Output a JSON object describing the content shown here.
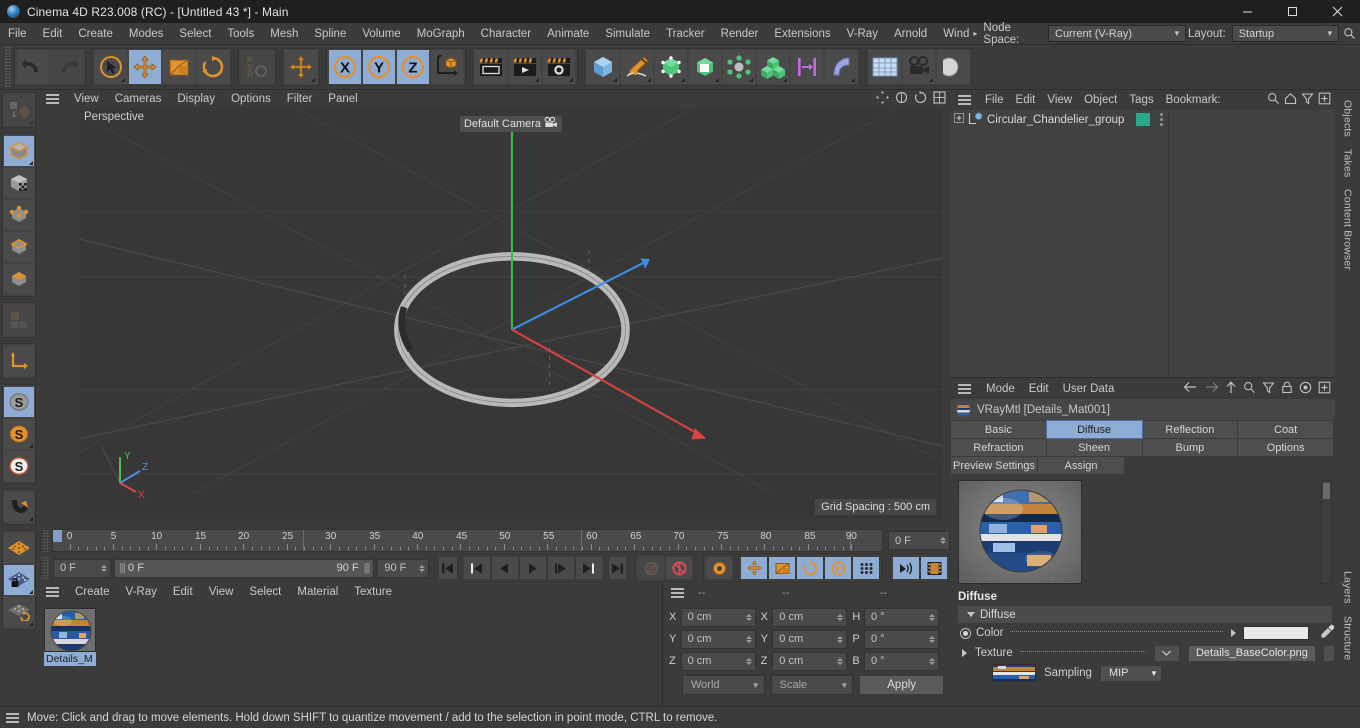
{
  "window": {
    "title": "Cinema 4D R23.008 (RC) - [Untitled 43 *] - Main",
    "minimize": "–",
    "maximize": "□",
    "close": "✕"
  },
  "menubar": {
    "items": [
      "File",
      "Edit",
      "Create",
      "Modes",
      "Select",
      "Tools",
      "Mesh",
      "Spline",
      "Volume",
      "MoGraph",
      "Character",
      "Animate",
      "Simulate",
      "Tracker",
      "Render",
      "Extensions",
      "V-Ray",
      "Arnold",
      "Wind"
    ],
    "overflow_arrow": "▸",
    "node_space_label": "Node Space:",
    "node_space_value": "Current (V-Ray)",
    "layout_label": "Layout:",
    "layout_value": "Startup",
    "search_icon": "search-icon"
  },
  "toolbar": {
    "groups": [
      {
        "name": "history",
        "buttons": [
          {
            "name": "undo-button",
            "icon": "undo-arrow-icon",
            "active": false,
            "disabled": false
          },
          {
            "name": "redo-button",
            "icon": "redo-arrow-icon",
            "active": false,
            "disabled": true
          }
        ]
      },
      {
        "name": "transform",
        "buttons": [
          {
            "name": "live-selection-tool",
            "icon": "cursor-circle-icon",
            "active": false,
            "disabled": false
          },
          {
            "name": "move-tool",
            "icon": "move-arrows-icon",
            "active": true,
            "disabled": false
          },
          {
            "name": "scale-tool",
            "icon": "scale-box-icon",
            "active": false,
            "disabled": false
          },
          {
            "name": "rotate-tool",
            "icon": "rotate-arrows-icon",
            "active": false,
            "disabled": false
          }
        ]
      },
      {
        "name": "psr",
        "buttons": [
          {
            "name": "psr-lock-button",
            "icon": "psr-icon",
            "active": false,
            "disabled": true
          }
        ]
      },
      {
        "name": "world-move",
        "buttons": [
          {
            "name": "world-move-tool",
            "icon": "move-arrows-icon",
            "active": false,
            "disabled": false
          }
        ]
      },
      {
        "name": "axis-locks",
        "buttons": [
          {
            "name": "lock-x-axis",
            "icon": "x-axis-icon",
            "label": "X",
            "active": true,
            "disabled": false
          },
          {
            "name": "lock-y-axis",
            "icon": "y-axis-icon",
            "label": "Y",
            "active": true,
            "disabled": false
          },
          {
            "name": "lock-z-axis",
            "icon": "z-axis-icon",
            "label": "Z",
            "active": true,
            "disabled": false
          },
          {
            "name": "object-world-coordinates",
            "icon": "object-axis-icon",
            "active": false,
            "disabled": false
          }
        ]
      },
      {
        "name": "render",
        "buttons": [
          {
            "name": "render-view-button",
            "icon": "render-view-icon",
            "active": false,
            "disabled": false
          },
          {
            "name": "render-to-picture-viewer-button",
            "icon": "render-picture-icon",
            "active": false,
            "disabled": false
          },
          {
            "name": "render-settings-button",
            "icon": "render-settings-icon",
            "active": false,
            "disabled": false
          }
        ]
      },
      {
        "name": "create",
        "buttons": [
          {
            "name": "primitive-cube-button",
            "icon": "cube-icon",
            "active": false,
            "disabled": false
          },
          {
            "name": "spline-pen-button",
            "icon": "pen-spline-icon",
            "active": false,
            "disabled": false
          },
          {
            "name": "generator-button",
            "icon": "generator-icon",
            "active": false,
            "disabled": false
          },
          {
            "name": "bend-deformer-button",
            "icon": "deformer-cube-icon",
            "active": false,
            "disabled": false
          },
          {
            "name": "mograph-button",
            "icon": "mograph-icon",
            "active": false,
            "disabled": false
          },
          {
            "name": "cloner-button",
            "icon": "cloner-cubes-icon",
            "active": false,
            "disabled": false
          },
          {
            "name": "scene-nodes-button",
            "icon": "array-icon",
            "active": false,
            "disabled": false
          },
          {
            "name": "deformer-bend-button",
            "icon": "bend-shape-icon",
            "active": false,
            "disabled": false
          }
        ]
      },
      {
        "name": "environment",
        "buttons": [
          {
            "name": "floor-environment-button",
            "icon": "floor-grid-icon",
            "active": false,
            "disabled": false
          },
          {
            "name": "camera-button",
            "icon": "camera-icon",
            "active": false,
            "disabled": false
          },
          {
            "name": "light-button",
            "icon": "light-icon",
            "active": false,
            "disabled": false
          }
        ]
      }
    ]
  },
  "left_toolbar": {
    "groups": [
      {
        "buttons": [
          {
            "name": "make-editable-button",
            "icon": "make-editable-icon",
            "active": false,
            "disabled": true
          }
        ]
      },
      {
        "buttons": [
          {
            "name": "model-mode-button",
            "icon": "model-cube-icon",
            "active": true
          },
          {
            "name": "texture-mode-button",
            "icon": "texture-cube-icon",
            "active": false
          },
          {
            "name": "points-mode-button",
            "icon": "points-cube-icon",
            "active": false
          },
          {
            "name": "edges-mode-button",
            "icon": "edges-cube-icon",
            "active": false
          },
          {
            "name": "polygons-mode-button",
            "icon": "polygons-cube-icon",
            "active": false
          }
        ]
      },
      {
        "buttons": [
          {
            "name": "uv-mode-button",
            "icon": "uv-grid-icon",
            "active": false,
            "disabled": true
          }
        ]
      },
      {
        "buttons": [
          {
            "name": "object-axis-mode-button",
            "icon": "axis-corner-icon",
            "active": false
          }
        ]
      },
      {
        "buttons": [
          {
            "name": "enable-axis-modification-button",
            "icon": "s-disc-gray-icon",
            "active": true
          },
          {
            "name": "viewport-solo-button",
            "icon": "s-disc-orange-icon",
            "active": false
          },
          {
            "name": "viewport-solo-hierarchy-button",
            "icon": "s-disc-white-icon",
            "active": false
          }
        ]
      },
      {
        "buttons": [
          {
            "name": "snap-magnet-button",
            "icon": "magnet-icon",
            "active": false
          }
        ]
      },
      {
        "buttons": [
          {
            "name": "workplane-button",
            "icon": "workplane-icon",
            "active": false
          },
          {
            "name": "lock-workplane-button",
            "icon": "workplane-lock-icon",
            "active": true
          },
          {
            "name": "planar-workplane-button",
            "icon": "workplane-rotate-icon",
            "active": false
          }
        ]
      }
    ]
  },
  "viewport": {
    "menu": [
      "View",
      "Cameras",
      "Display",
      "Options",
      "Filter",
      "Panel"
    ],
    "hamburger_icon": "hamburger-icon",
    "label": "Perspective",
    "camera_tag": "Default Camera",
    "camera_tag_icon": "camera-icon",
    "grid_spacing": "Grid Spacing : 500 cm",
    "axis_gizmo": {
      "x_label": "X",
      "y_label": "Y",
      "z_label": "Z",
      "x_color": "#d84a4a",
      "y_color": "#4fc04f",
      "z_color": "#4a8fe0"
    },
    "corner_icons": [
      "move-panel-icon",
      "pan-icon",
      "rotate-view-icon",
      "maximize-view-icon"
    ]
  },
  "timeline": {
    "start_tick": 0,
    "end_tick": 90,
    "tick_step": 5,
    "labels": [
      "0",
      "5",
      "10",
      "15",
      "20",
      "25",
      "30",
      "35",
      "40",
      "45",
      "50",
      "55",
      "60",
      "65",
      "70",
      "75",
      "80",
      "85",
      "90"
    ],
    "marker_frames": [
      30,
      60
    ],
    "current_frame_field": "0 F"
  },
  "playback": {
    "current_frame": "0 F",
    "range_start": "0 F",
    "range_end": "90 F",
    "end_frame_field": "90 F",
    "buttons": [
      {
        "name": "go-to-start-button",
        "icon": "skip-start-icon",
        "active": false
      },
      {
        "name": "go-to-previous-key-button",
        "icon": "prev-key-icon",
        "active": false
      },
      {
        "name": "step-back-button",
        "icon": "step-back-icon",
        "active": false
      },
      {
        "name": "play-button",
        "icon": "play-icon",
        "active": false
      },
      {
        "name": "step-forward-button",
        "icon": "step-forward-icon",
        "active": false
      },
      {
        "name": "go-to-next-key-button",
        "icon": "next-key-icon",
        "active": false
      },
      {
        "name": "go-to-end-button",
        "icon": "skip-end-icon",
        "active": false
      },
      {
        "name": "record-active-objects-button",
        "icon": "record-key-icon",
        "active": false,
        "disabled": true
      },
      {
        "name": "autokeying-button",
        "icon": "autokey-icon",
        "active": false
      },
      {
        "name": "keyframe-selection-button",
        "icon": "keyframe-gear-icon",
        "active": false
      },
      {
        "name": "position-key-button",
        "icon": "move-arrows-icon",
        "active": true
      },
      {
        "name": "scale-key-button",
        "icon": "scale-box-icon",
        "active": true
      },
      {
        "name": "rotation-key-button",
        "icon": "rotate-arrows-icon",
        "active": true
      },
      {
        "name": "parameter-key-button",
        "icon": "param-p-icon",
        "active": true
      },
      {
        "name": "point-level-animation-button",
        "icon": "pla-dots-icon",
        "active": true
      },
      {
        "name": "sound-button",
        "icon": "sound-icon",
        "active": true
      },
      {
        "name": "film-strip-button",
        "icon": "film-strip-icon",
        "active": true
      }
    ]
  },
  "material_manager": {
    "menu": [
      "Create",
      "V-Ray",
      "Edit",
      "View",
      "Select",
      "Material",
      "Texture"
    ],
    "hamburger_icon": "hamburger-icon",
    "materials": [
      {
        "name": "Details_M",
        "selected": true
      }
    ]
  },
  "coordinates": {
    "hamburger_icon": "hamburger-icon",
    "column_headers": [
      "--",
      "--",
      "--"
    ],
    "rows": [
      {
        "pos_label": "X",
        "pos_value": "0 cm",
        "size_label": "X",
        "size_value": "0 cm",
        "rot_label": "H",
        "rot_value": "0 °"
      },
      {
        "pos_label": "Y",
        "pos_value": "0 cm",
        "size_label": "Y",
        "size_value": "0 cm",
        "rot_label": "P",
        "rot_value": "0 °"
      },
      {
        "pos_label": "Z",
        "pos_value": "0 cm",
        "size_label": "Z",
        "size_value": "0 cm",
        "rot_label": "B",
        "rot_value": "0 °"
      }
    ],
    "system_select": "World",
    "mode_select": "Scale",
    "apply_button": "Apply"
  },
  "object_manager": {
    "menu": [
      "File",
      "Edit",
      "View",
      "Object",
      "Tags",
      "Bookmark:"
    ],
    "hamburger_icon": "hamburger-icon",
    "icons": [
      "search-icon",
      "home-icon",
      "filter-icon",
      "add-icon"
    ],
    "objects": [
      {
        "name": "Circular_Chandelier_group",
        "expandable": true,
        "icon": "null-object-icon",
        "tag_color": "#2aa88b"
      }
    ]
  },
  "attribute_manager": {
    "menu": [
      "Mode",
      "Edit",
      "User Data"
    ],
    "hamburger_icon": "hamburger-icon",
    "icons": [
      "back-arrow-icon",
      "forward-arrow-icon",
      "up-arrow-icon",
      "search-icon",
      "filter-icon",
      "lock-icon",
      "target-icon",
      "add-icon"
    ],
    "object_title": "VRayMtl [Details_Mat001]",
    "tabs": [
      [
        {
          "label": "Basic",
          "active": false
        },
        {
          "label": "Diffuse",
          "active": true
        },
        {
          "label": "Reflection",
          "active": false
        },
        {
          "label": "Coat",
          "active": false
        }
      ],
      [
        {
          "label": "Refraction",
          "active": false
        },
        {
          "label": "Sheen",
          "active": false
        },
        {
          "label": "Bump",
          "active": false
        },
        {
          "label": "Options",
          "active": false
        }
      ],
      [
        {
          "label": "Preview Settings",
          "active": false
        },
        {
          "label": "Assign",
          "active": false
        }
      ]
    ],
    "section_title": "Diffuse",
    "group_label": "Diffuse",
    "properties": {
      "color_label": "Color",
      "color_dots": ". . . . . . . . . .",
      "color_value": "#e9e9e9",
      "eyedropper_icon": "eyedropper-icon",
      "texture_label": "Texture",
      "texture_dots": ". . . . . . . . .",
      "texture_value": "Details_BaseColor.png",
      "sampling_label": "Sampling",
      "sampling_value": "MIP"
    }
  },
  "right_tabs": [
    "Objects",
    "Takes",
    "Content Browser",
    "Layers",
    "Structure"
  ],
  "status_bar": {
    "hamburger_icon": "hamburger-icon",
    "message": "Move: Click and drag to move elements. Hold down SHIFT to quantize movement / add to the selection in point mode, CTRL to remove."
  }
}
